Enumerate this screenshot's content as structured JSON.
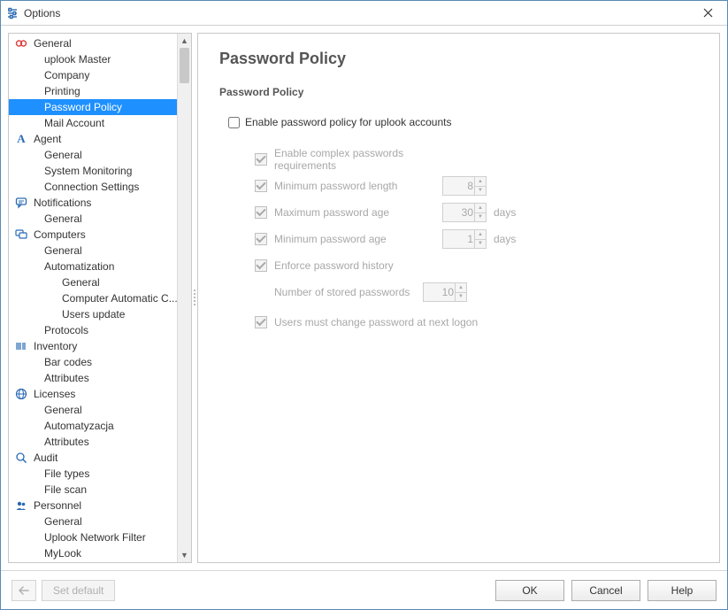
{
  "window": {
    "title": "Options"
  },
  "tree": {
    "general": {
      "label": "General",
      "uplook_master": "uplook Master",
      "company": "Company",
      "printing": "Printing",
      "password_policy": "Password Policy",
      "mail_account": "Mail Account"
    },
    "agent": {
      "label": "Agent",
      "general": "General",
      "system_monitoring": "System Monitoring",
      "connection_settings": "Connection Settings"
    },
    "notifications": {
      "label": "Notifications",
      "general": "General"
    },
    "computers": {
      "label": "Computers",
      "general": "General",
      "automatization": "Automatization",
      "auto_general": "General",
      "auto_computer_automatic": "Computer Automatic C...",
      "auto_users_update": "Users update",
      "protocols": "Protocols"
    },
    "inventory": {
      "label": "Inventory",
      "bar_codes": "Bar codes",
      "attributes": "Attributes"
    },
    "licenses": {
      "label": "Licenses",
      "general": "General",
      "automatyzacja": "Automatyzacja",
      "attributes": "Attributes"
    },
    "audit": {
      "label": "Audit",
      "file_types": "File types",
      "file_scan": "File scan"
    },
    "personnel": {
      "label": "Personnel",
      "general": "General",
      "uplook_network_filter": "Uplook Network Filter",
      "mylook": "MyLook"
    }
  },
  "main": {
    "heading": "Password Policy",
    "section": "Password Policy",
    "enable_label": "Enable password policy for uplook accounts",
    "complex_label": "Enable complex passwords requirements",
    "min_len_label": "Minimum password length",
    "min_len_value": "8",
    "max_age_label": "Maximum password age",
    "max_age_value": "30",
    "max_age_unit": "days",
    "min_age_label": "Minimum password age",
    "min_age_value": "1",
    "min_age_unit": "days",
    "enforce_history_label": "Enforce password history",
    "stored_pw_label": "Number of stored passwords",
    "stored_pw_value": "10",
    "must_change_label": "Users must change password at next logon"
  },
  "footer": {
    "set_default": "Set default",
    "ok": "OK",
    "cancel": "Cancel",
    "help": "Help"
  }
}
